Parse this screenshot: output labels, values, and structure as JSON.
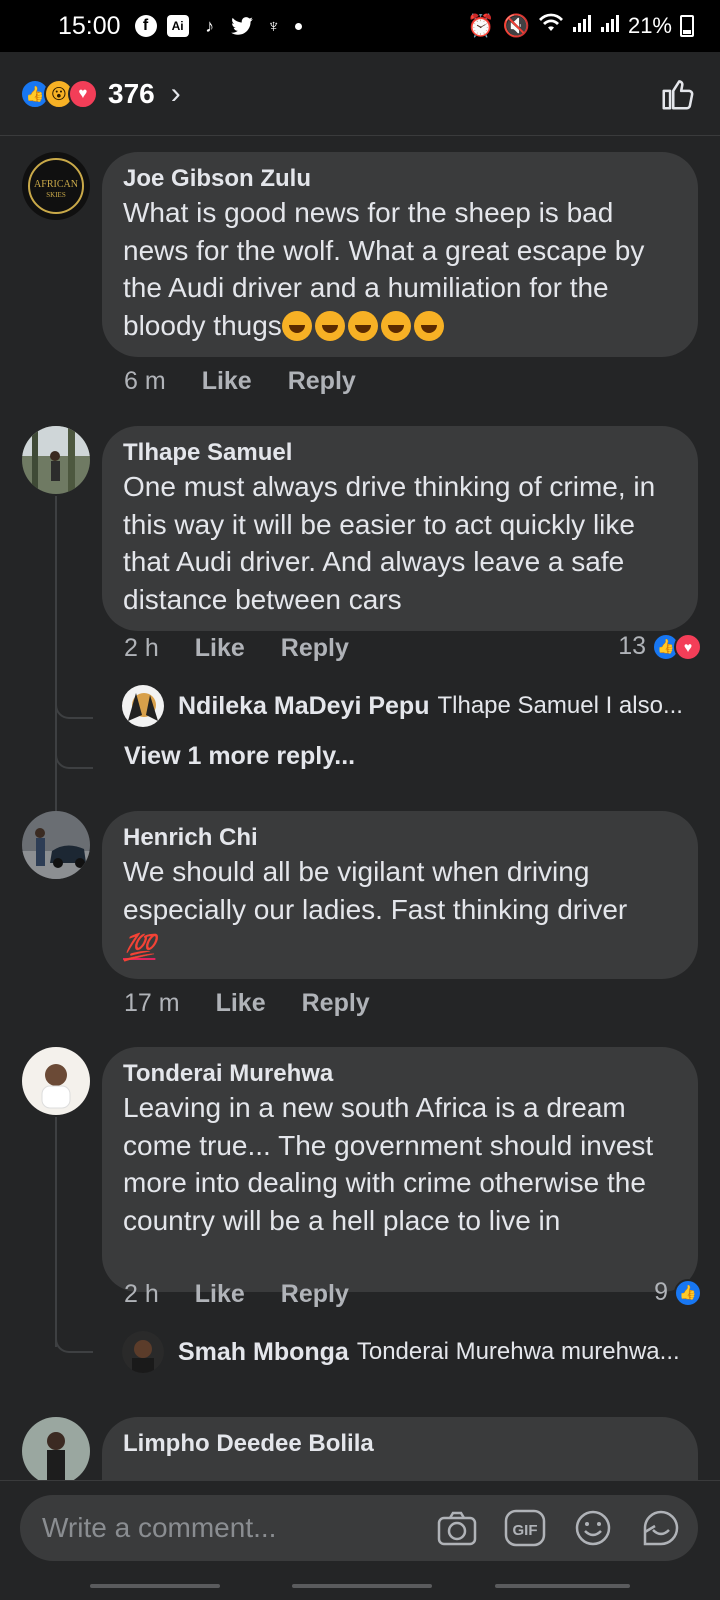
{
  "status_bar": {
    "time": "15:00",
    "battery": "21%",
    "icons": [
      "facebook-icon",
      "ai-icon",
      "tiktok-icon",
      "twitter-icon",
      "app-icon",
      "alarm-icon",
      "mute-icon",
      "wifi-icon",
      "signal-icon",
      "signal-icon",
      "battery-icon"
    ]
  },
  "header": {
    "reaction_count": "376",
    "reactions": [
      "like",
      "wow",
      "love"
    ]
  },
  "comments": [
    {
      "author": "Joe Gibson Zulu",
      "text": "What is good news for the sheep is bad news for the wolf. What a great escape by the Audi driver and a humiliation for the bloody thugs",
      "emoji": "rolling-on-floor-laughing x5",
      "time": "6 m",
      "like_label": "Like",
      "reply_label": "Reply"
    },
    {
      "author": "Tlhape Samuel",
      "text": "One must always drive thinking of crime, in this way it will be easier to act quickly like that Audi driver. And always leave a safe distance between cars",
      "time": "2 h",
      "like_label": "Like",
      "reply_label": "Reply",
      "reaction_count": "13",
      "reply_preview": {
        "author": "Ndileka MaDeyi Pepu",
        "snippet": "Tlhape Samuel I also..."
      },
      "view_more": "View 1 more reply..."
    },
    {
      "author": "Henrich Chi",
      "text": "We should all be vigilant when driving especially our ladies. Fast thinking driver",
      "emoji": "💯",
      "time": "17 m",
      "like_label": "Like",
      "reply_label": "Reply"
    },
    {
      "author": "Tonderai Murehwa",
      "text": "Leaving in a new south Africa is a dream come true... The government should invest more into dealing with crime otherwise the country will be a hell place to live in",
      "time": "2 h",
      "like_label": "Like",
      "reply_label": "Reply",
      "reaction_count": "9",
      "reply_preview": {
        "author": "Smah Mbonga",
        "snippet": "Tonderai Murehwa murehwa..."
      }
    },
    {
      "author": "Limpho Deedee Bolila"
    }
  ],
  "composer": {
    "placeholder": "Write a comment...",
    "gif_label": "GIF"
  },
  "colors": {
    "background": "#242526",
    "bubble": "#3a3b3c",
    "like_blue": "#1877f2",
    "love_red": "#f33e58"
  }
}
